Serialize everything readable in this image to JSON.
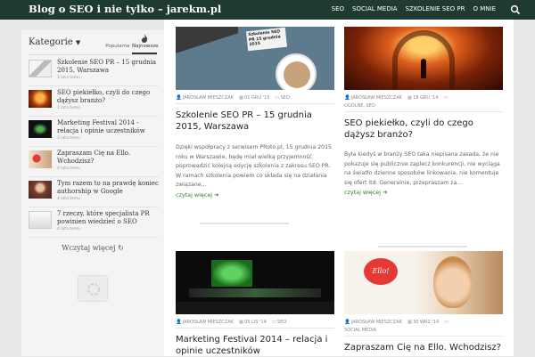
{
  "header": {
    "site_title": "Blog o SEO i nie tylko – jarekm.pl",
    "nav": [
      "SEO",
      "SOCIAL MEDIA",
      "SZKOLENIE SEO PR",
      "O MNIE"
    ],
    "search_icon": "search-icon",
    "bg_color": "#1f3b2f"
  },
  "sidebar": {
    "heading": "Kategorie",
    "tabs": [
      {
        "label": "Popularne",
        "icon": "list-icon"
      },
      {
        "label": "Najnowsze",
        "icon": "fire-icon"
      }
    ],
    "items": [
      {
        "title": "Szkolenie SEO PR – 15 grudnia 2015, Warszawa",
        "ago": "1 lata temu"
      },
      {
        "title": "SEO piekiełko, czyli do czego dążysz branżo?",
        "ago": "1 lata temu"
      },
      {
        "title": "Marketing Festival 2014 - relacja i opinie uczestników",
        "ago": "3 lata temu"
      },
      {
        "title": "Zapraszam Cię na Ello. Wchodzisz?",
        "ago": "4 lata temu"
      },
      {
        "title": "Tym razem to na prawdę koniec authorship w Google",
        "ago": "4 lata temu"
      },
      {
        "title": "7 rzeczy, które specjalista PR powinien wiedzieć o SEO",
        "ago": "4 lata temu"
      }
    ],
    "load_more": "Wczytaj więcej"
  },
  "posts": [
    {
      "author": "JAROSŁAW MIESZCZAK",
      "date": "01 GRU '15",
      "category": "SEO",
      "title": "Szkolenie SEO PR – 15 grudnia 2015, Warszawa",
      "excerpt": "Dzięki współpracy z serwisem PRoto.pl, 15 grudnia 2015 roku w Warszawie, będę miał wielką przyjemność poprowadzić kolejną edycję szkolenia z zakresu SEO PR. W ramach szkolenia powiem co składa się na działania związane...",
      "more": "czytaj więcej",
      "image_text": "Szkolenie SEO PR 15 grudnia 2015"
    },
    {
      "author": "JAROSŁAW MIESZCZAK",
      "date": "18 GRU '14",
      "category": "",
      "category2": "OGÓLNE, SEO",
      "title": "SEO piekiełko, czyli do czego dążysz branżo?",
      "excerpt": "Była kiedyś w branży SEO taka niepisana zasada, że nie pokazuje się publicznie zaplecz konkurencji, nie wyciąga na światło dzienne sposobów linkowania, nie komentuje się ofert itd. Generalnie, przepraszam za...",
      "more": "czytaj więcej"
    },
    {
      "author": "JAROSŁAW MIESZCZAK",
      "date": "05 LIS '14",
      "category": "SEO",
      "title": "Marketing Festival 2014 – relacja i opinie uczestników"
    },
    {
      "author": "JAROSŁAW MIESZCZAK",
      "date": "30 WRZ '14",
      "category": "",
      "category2": "SOCIAL MEDIA",
      "title": "Zapraszam Cię na Ello. Wchodzisz?",
      "image_text": "Ello!"
    }
  ]
}
